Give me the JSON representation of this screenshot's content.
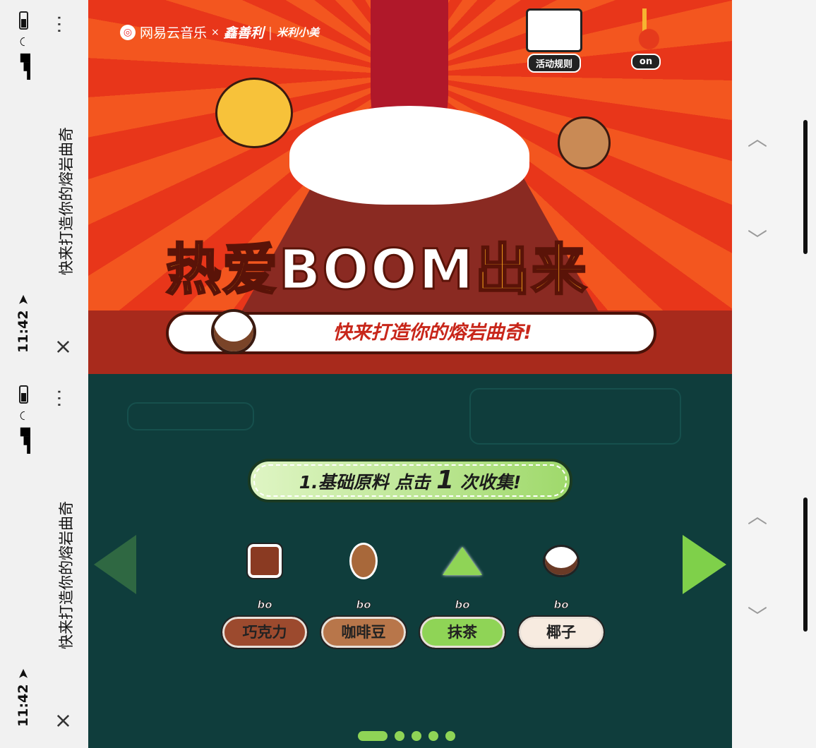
{
  "status_bar": {
    "time": "11:42",
    "title": "快来打造你的熔岩曲奇",
    "more_icon": "more-vertical-icon",
    "close_icon": "close-icon",
    "battery_icon": "battery-icon",
    "wifi_icon": "wifi-icon",
    "signal_icon": "signal-icon",
    "location_icon": "location-arrow-icon"
  },
  "banner": {
    "brand": "网易云音乐",
    "x": "×",
    "partner1": "鑫善利",
    "partner2": "米利小美",
    "rules_label": "活动规则",
    "music_label": "on",
    "headline_prefix": "热爱",
    "headline_boom": "BOOM",
    "headline_suffix": "出来",
    "subtitle": "快来打造你的熔岩曲奇!"
  },
  "game": {
    "instruction_prefix": "1.基础原料  点击",
    "instruction_count": "1",
    "instruction_suffix": "次收集!",
    "ingredients": [
      {
        "count": "bo",
        "name": "巧克力",
        "color": "#9c4a2e"
      },
      {
        "count": "bo",
        "name": "咖啡豆",
        "color": "#b8764a"
      },
      {
        "count": "bo",
        "name": "抹茶",
        "color": "#8fd456"
      },
      {
        "count": "bo",
        "name": "椰子",
        "color": "#f7ebe0"
      }
    ],
    "pages": 5,
    "current_page": 1
  },
  "colors": {
    "banner_red": "#e8361a",
    "game_bg": "#0f3d3c",
    "accent_green": "#8fd456"
  }
}
